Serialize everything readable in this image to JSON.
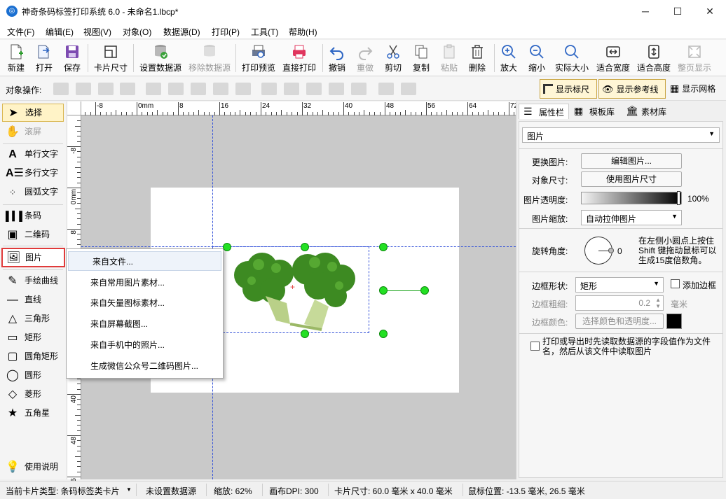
{
  "window": {
    "title": "神奇条码标签打印系统 6.0 - 未命名1.lbcp*",
    "app_icon": "app-logo-icon"
  },
  "menu": [
    "文件(F)",
    "编辑(E)",
    "视图(V)",
    "对象(O)",
    "数据源(D)",
    "打印(P)",
    "工具(T)",
    "帮助(H)"
  ],
  "toolbar": [
    {
      "label": "新建",
      "icon": "new-file-icon",
      "enabled": true
    },
    {
      "label": "打开",
      "icon": "open-icon",
      "enabled": true
    },
    {
      "label": "保存",
      "icon": "save-icon",
      "enabled": true
    },
    {
      "label": "卡片尺寸",
      "icon": "card-size-icon",
      "enabled": true
    },
    {
      "label": "设置数据源",
      "icon": "database-icon",
      "enabled": true
    },
    {
      "label": "移除数据源",
      "icon": "database-remove-icon",
      "enabled": false
    },
    {
      "label": "打印预览",
      "icon": "print-preview-icon",
      "enabled": true
    },
    {
      "label": "直接打印",
      "icon": "printer-icon",
      "enabled": true
    },
    {
      "label": "撤销",
      "icon": "undo-icon",
      "enabled": true
    },
    {
      "label": "重做",
      "icon": "redo-icon",
      "enabled": false
    },
    {
      "label": "剪切",
      "icon": "scissors-icon",
      "enabled": true
    },
    {
      "label": "复制",
      "icon": "copy-icon",
      "enabled": true
    },
    {
      "label": "粘贴",
      "icon": "paste-icon",
      "enabled": false
    },
    {
      "label": "删除",
      "icon": "trash-icon",
      "enabled": true
    },
    {
      "label": "放大",
      "icon": "zoom-in-icon",
      "enabled": true
    },
    {
      "label": "缩小",
      "icon": "zoom-out-icon",
      "enabled": true
    },
    {
      "label": "实际大小",
      "icon": "zoom-actual-icon",
      "enabled": true
    },
    {
      "label": "适合宽度",
      "icon": "fit-width-icon",
      "enabled": true
    },
    {
      "label": "适合高度",
      "icon": "fit-height-icon",
      "enabled": true
    },
    {
      "label": "整页显示",
      "icon": "fit-page-icon",
      "enabled": false
    }
  ],
  "objbar": {
    "label": "对象操作:",
    "show_ruler": "显示标尺",
    "show_guides": "显示参考线",
    "show_grid": "显示网格"
  },
  "tools": [
    {
      "label": "选择",
      "icon": "pointer-icon",
      "state": "selected"
    },
    {
      "label": "滚屏",
      "icon": "hand-icon",
      "state": "disabled"
    },
    {
      "label": "单行文字",
      "icon": "single-line-text-icon",
      "state": "normal"
    },
    {
      "label": "多行文字",
      "icon": "multi-line-text-icon",
      "state": "normal"
    },
    {
      "label": "圆弧文字",
      "icon": "arc-text-icon",
      "state": "normal"
    },
    {
      "label": "条码",
      "icon": "barcode-icon",
      "state": "normal"
    },
    {
      "label": "二维码",
      "icon": "qrcode-icon",
      "state": "normal"
    },
    {
      "label": "图片",
      "icon": "image-icon",
      "state": "active"
    },
    {
      "label": "手绘曲线",
      "icon": "pen-icon",
      "state": "normal"
    },
    {
      "label": "直线",
      "icon": "line-icon",
      "state": "normal"
    },
    {
      "label": "三角形",
      "icon": "triangle-icon",
      "state": "normal"
    },
    {
      "label": "矩形",
      "icon": "rectangle-icon",
      "state": "normal"
    },
    {
      "label": "圆角矩形",
      "icon": "rounded-rectangle-icon",
      "state": "normal"
    },
    {
      "label": "圆形",
      "icon": "circle-icon",
      "state": "normal"
    },
    {
      "label": "菱形",
      "icon": "diamond-icon",
      "state": "normal"
    },
    {
      "label": "五角星",
      "icon": "star-icon",
      "state": "normal"
    },
    {
      "label": "使用说明",
      "icon": "lightbulb-icon",
      "state": "normal"
    }
  ],
  "ruler": {
    "h_labels": [
      "-8",
      "0mm",
      "8",
      "16",
      "24",
      "32",
      "40",
      "48",
      "56",
      "64",
      "72"
    ],
    "v_labels": [
      "-8",
      "0mm",
      "8",
      "16",
      "24",
      "32",
      "40",
      "48",
      "56"
    ]
  },
  "context_menu": {
    "items": [
      "来自文件...",
      "来自常用图片素材...",
      "来自矢量图标素材...",
      "来自屏幕截图...",
      "来自手机中的照片...",
      "生成微信公众号二维码图片..."
    ],
    "highlighted": 0
  },
  "right_panel": {
    "tabs": [
      "属性栏",
      "模板库",
      "素材库"
    ],
    "object_type": "图片",
    "replace_label": "更换图片:",
    "edit_image_btn": "编辑图片...",
    "size_label": "对象尺寸:",
    "use_image_size_btn": "使用图片尺寸",
    "opacity_label": "图片透明度:",
    "opacity_value": "100%",
    "opacity_fraction": 1.0,
    "scale_label": "图片缩放:",
    "scale_value": "自动拉伸图片",
    "rotate_label": "旋转角度:",
    "rotate_value": "0",
    "rotate_hint": "在左侧小圆点上按住 Shift 键拖动鼠标可以生成15度倍数角。",
    "border_shape_label": "边框形状:",
    "border_shape_value": "矩形",
    "add_border_label": "添加边框",
    "border_width_label": "边框粗细:",
    "border_width_value": "0.2",
    "border_width_unit": "毫米",
    "border_color_label": "边框颜色:",
    "border_color_btn": "选择颜色和透明度...",
    "border_color": "#000000",
    "datasource_check_label": "打印或导出时先读取数据源的字段值作为文件名，然后从该文件中读取图片"
  },
  "status": {
    "card_type": "当前卡片类型: 条码标签类卡片",
    "datasource": "未设置数据源",
    "zoom": "缩放: 62%",
    "dpi": "画布DPI: 300",
    "card_size": "卡片尺寸: 60.0 毫米 x 40.0 毫米",
    "mouse_pos": "鼠标位置: -13.5 毫米, 26.5 毫米"
  },
  "colors": {
    "accent_red": "#e03a3a",
    "handle_green": "#23e023",
    "guide_blue": "#3553d9",
    "selected_tool_bg": "#fff3c7"
  }
}
